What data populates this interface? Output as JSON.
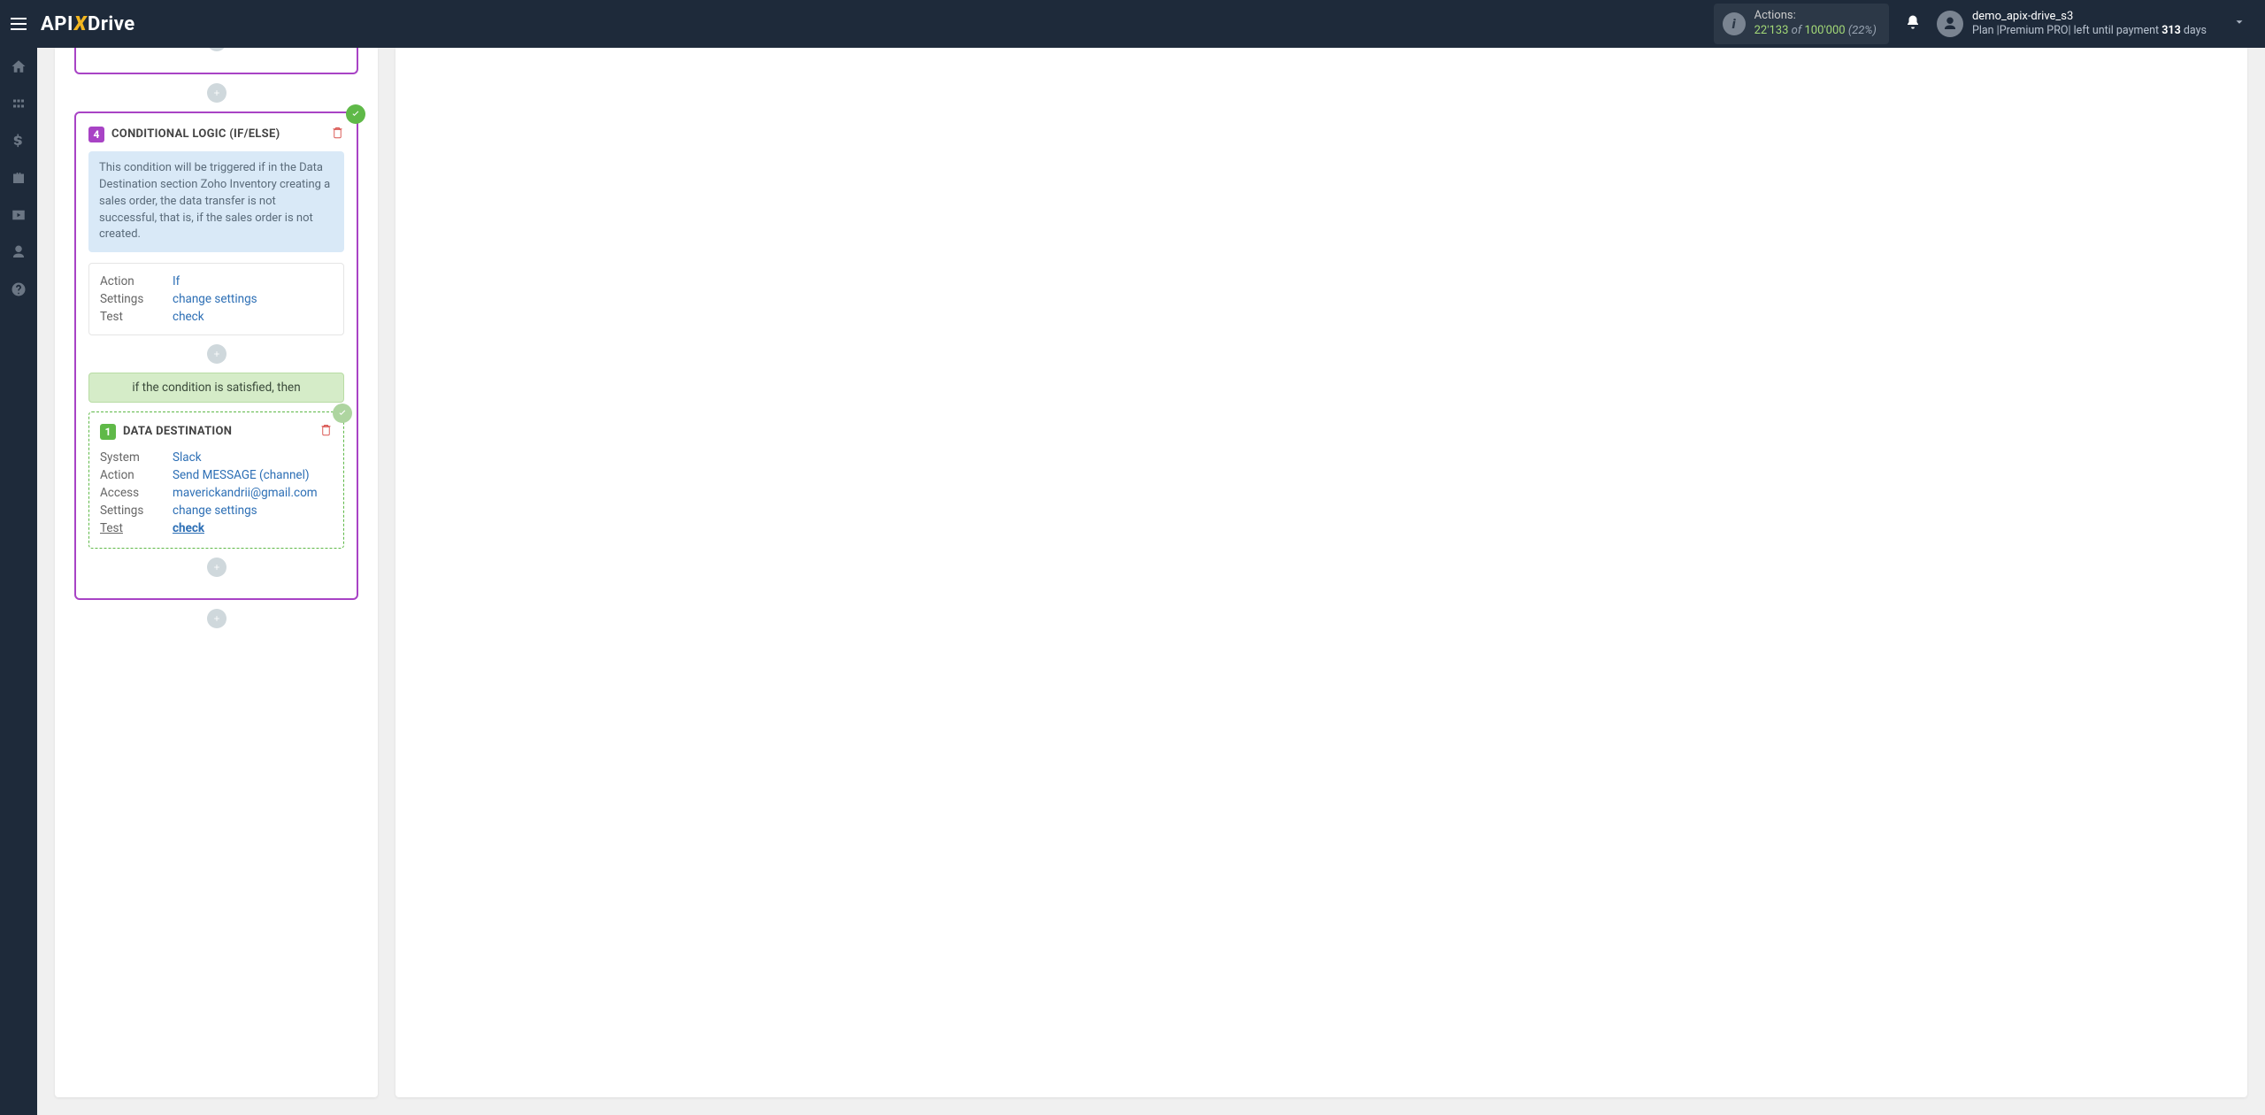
{
  "header": {
    "logo": {
      "api": "API",
      "drive": "Drive"
    },
    "actions": {
      "label": "Actions:",
      "used": "22'133",
      "of": "of",
      "total": "100'000",
      "pct": "(22%)"
    },
    "user": {
      "name": "demo_apix-drive_s3",
      "plan_prefix": "Plan |Premium PRO| left until payment ",
      "days_num": "313",
      "days_suffix": " days"
    }
  },
  "card4": {
    "num": "4",
    "title": "CONDITIONAL LOGIC (IF/ELSE)",
    "info": "This condition will be triggered if in the Data Destination section Zoho Inventory creating a sales order, the data transfer is not successful, that is, if the sales order is not created.",
    "props": {
      "action_label": "Action",
      "action_value": "If",
      "settings_label": "Settings",
      "settings_value": "change settings",
      "test_label": "Test",
      "test_value": "check"
    }
  },
  "cond_banner": "if the condition is satisfied, then",
  "nested": {
    "num": "1",
    "title": "DATA DESTINATION",
    "props": {
      "system_label": "System",
      "system_value": "Slack",
      "action_label": "Action",
      "action_value": "Send MESSAGE (channel)",
      "access_label": "Access",
      "access_value": "maverickandrii@gmail.com",
      "settings_label": "Settings",
      "settings_value": "change settings",
      "test_label": "Test",
      "test_value": "check"
    }
  }
}
